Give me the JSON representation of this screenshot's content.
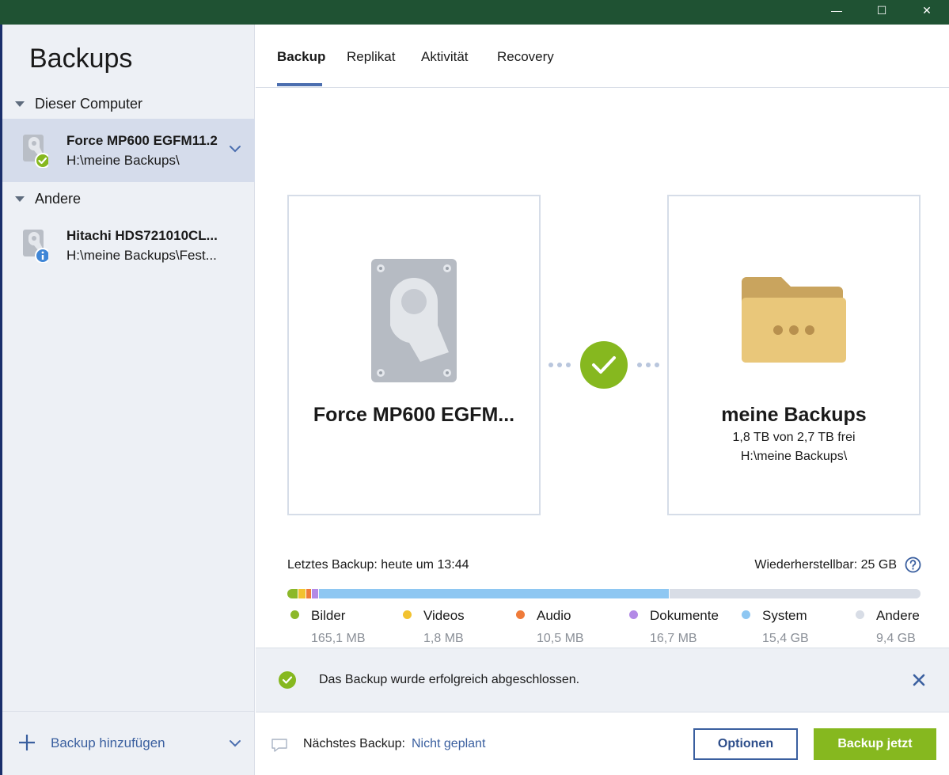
{
  "window": {
    "minimize_symbol": "—",
    "maximize_symbol": "☐",
    "close_symbol": "✕",
    "titlebar_color": "#1f5233"
  },
  "sidebar": {
    "title": "Backups",
    "groups": [
      {
        "label": "Dieser Computer",
        "items": [
          {
            "name": "Force MP600 EGFM11.2",
            "path": "H:\\meine Backups\\",
            "status": "success",
            "selected": true
          }
        ]
      },
      {
        "label": "Andere",
        "items": [
          {
            "name": "Hitachi HDS721010CL...",
            "path": "H:\\meine Backups\\Fest...",
            "status": "info",
            "selected": false
          }
        ]
      }
    ],
    "add_backup_label": "Backup hinzufügen"
  },
  "tabs": [
    {
      "label": "Backup",
      "active": true
    },
    {
      "label": "Replikat",
      "active": false
    },
    {
      "label": "Aktivität",
      "active": false
    },
    {
      "label": "Recovery",
      "active": false
    }
  ],
  "source": {
    "title": "Force MP600 EGFM...",
    "icon": "hard-drive-icon"
  },
  "destination": {
    "title": "meine Backups",
    "free_space": "1,8 TB von 2,7 TB frei",
    "path": "H:\\meine Backups\\",
    "icon": "folder-icon"
  },
  "status_summary": {
    "last_backup": "Letztes Backup: heute um 13:44",
    "restorable": "Wiederherstellbar: 25 GB"
  },
  "usage": {
    "segments": [
      {
        "name": "Bilder",
        "size": "165,1 MB",
        "color": "#8cb82a",
        "fraction": 0.018
      },
      {
        "name": "Videos",
        "size": "1,8 MB",
        "color": "#f2c230",
        "fraction": 0.012
      },
      {
        "name": "Audio",
        "size": "10,5 MB",
        "color": "#ef7b3a",
        "fraction": 0.009
      },
      {
        "name": "Dokumente",
        "size": "16,7 MB",
        "color": "#b38ae6",
        "fraction": 0.011
      },
      {
        "name": "System",
        "size": "15,4 GB",
        "color": "#8ec7f2",
        "fraction": 0.554
      },
      {
        "name": "Andere",
        "size": "9,4 GB",
        "color": "#d8dde6",
        "fraction": 0.396
      }
    ]
  },
  "notification": {
    "text": "Das Backup wurde erfolgreich abgeschlossen."
  },
  "footer": {
    "next_backup_label": "Nächstes Backup:",
    "next_backup_value": "Nicht geplant",
    "options_label": "Optionen",
    "backup_now_label": "Backup jetzt"
  },
  "colors": {
    "accent_blue": "#3a5f9f",
    "success_green": "#86b81f",
    "sidebar_bg": "#edf0f5"
  }
}
